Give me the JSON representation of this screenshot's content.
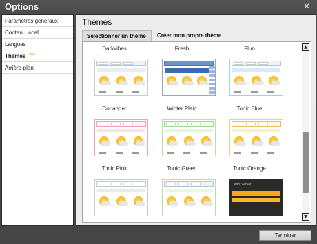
{
  "window": {
    "title": "Options",
    "close_glyph": "✕"
  },
  "sidebar": {
    "items": [
      {
        "label": "Paramètres généraux"
      },
      {
        "label": "Contenu local"
      },
      {
        "label": "Langues"
      },
      {
        "label": "Thèmes",
        "badge": "new"
      },
      {
        "label": "Arrière-plan"
      }
    ]
  },
  "main": {
    "title": "Thèmes",
    "tabs": [
      {
        "label": "Sélectionner un thème"
      },
      {
        "label": "Créer mon propre thème"
      }
    ],
    "themes": [
      {
        "name": "Darkvibes"
      },
      {
        "name": "Fresh"
      },
      {
        "name": "Fluo"
      },
      {
        "name": "Coriander"
      },
      {
        "name": "Winter Plain"
      },
      {
        "name": "Tonic Blue"
      },
      {
        "name": "Tonic Pink"
      },
      {
        "name": "Tonic Green"
      },
      {
        "name": "Tonic Orange"
      }
    ],
    "preview_text": {
      "add_content": "Add content"
    }
  },
  "scrollbar": {
    "up": "▲",
    "down": "▼"
  },
  "footer": {
    "finish_label": "Terminer"
  }
}
